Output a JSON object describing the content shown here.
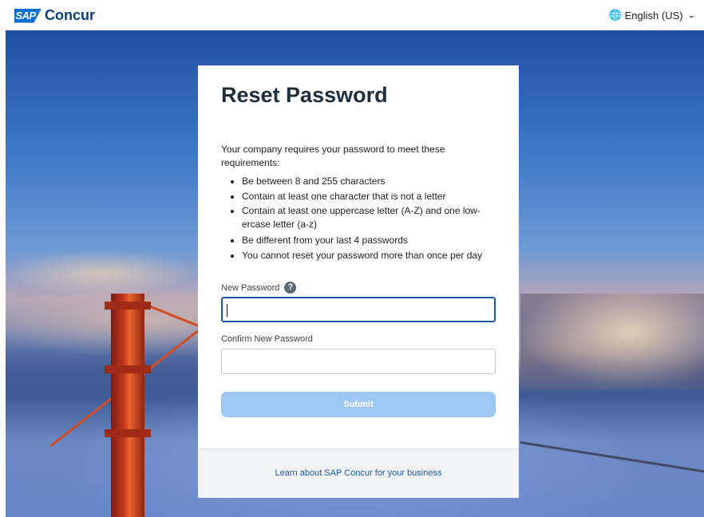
{
  "header": {
    "logo_mark": "SAP",
    "brand": "Concur",
    "language": "English (US)",
    "icons": [
      "globe-icon",
      "chevron-down-icon"
    ]
  },
  "card": {
    "title": "Reset Password",
    "requirements_intro": "Your company requires your password to meet these requirements:",
    "requirements": [
      "Be between 8 and 255 characters",
      "Contain at least one character that is not a letter",
      "Contain at least one uppercase letter (A-Z) and one low-ercase letter (a-z)",
      "Be different from your last 4 passwords",
      "You cannot reset your password more than once per day"
    ],
    "new_password_label": "New Password",
    "new_password_value": "",
    "confirm_password_label": "Confirm New Password",
    "confirm_password_value": "",
    "submit_label": "Submit",
    "help_icon": "question-circle-icon",
    "footer_link": "Learn about SAP Concur for your business"
  },
  "colors": {
    "brand_blue": "#0a6ed1",
    "submit_disabled": "#9ec8f4",
    "link": "#1a5aa8",
    "focus_border": "#1a5aa8"
  }
}
